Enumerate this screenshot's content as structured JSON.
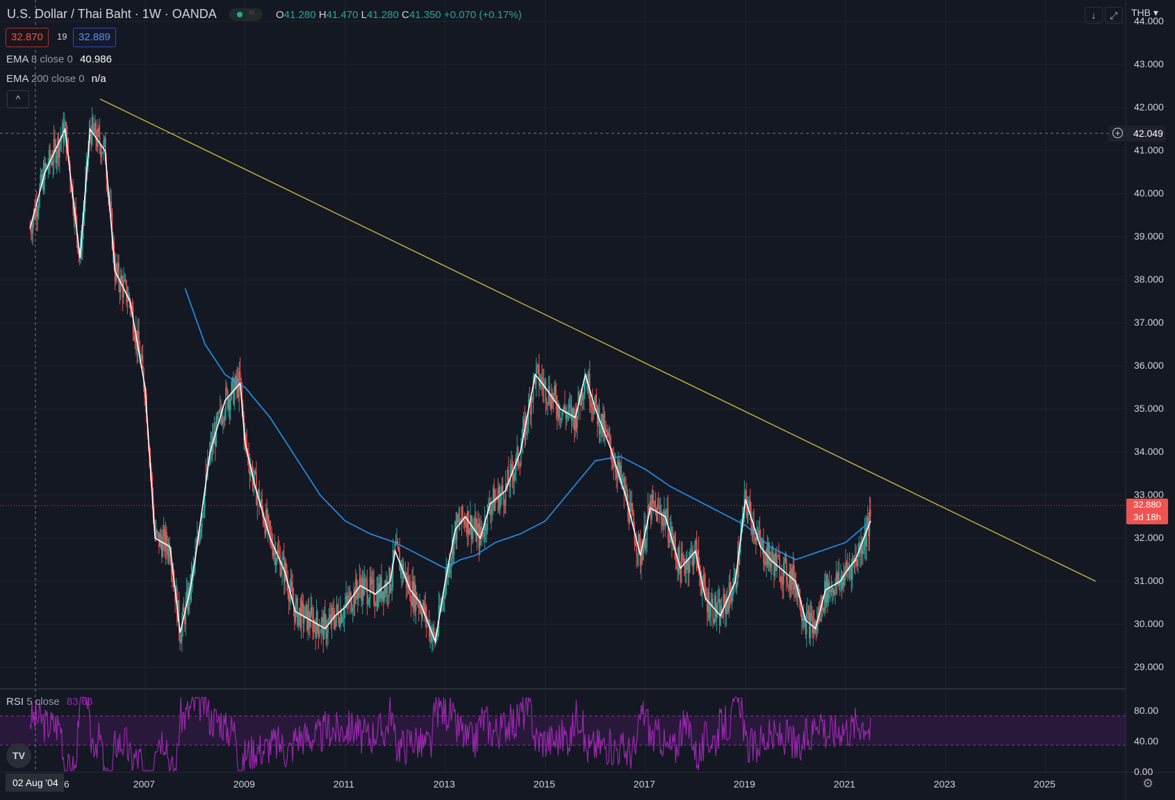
{
  "header": {
    "symbol": "U.S. Dollar / Thai Baht",
    "interval": "1W",
    "exchange": "OANDA",
    "ohlc": {
      "o_label": "O",
      "o": "41.280",
      "h_label": "H",
      "h": "41.470",
      "l_label": "L",
      "l": "41.280",
      "c_label": "C",
      "c": "41.350",
      "change": "+0.070 (+0.17%)"
    },
    "sell_price": "32.870",
    "spread": "19",
    "buy_price": "32.889"
  },
  "indicators": {
    "ema8": {
      "name": "EMA",
      "params": "8 close 0",
      "value": "40.986"
    },
    "ema200": {
      "name": "EMA",
      "params": "200 close 0",
      "value": "n/a"
    },
    "rsi": {
      "name": "RSI",
      "params": "5 close",
      "value": "83.66"
    }
  },
  "toolbar": {
    "collapse_icon": "^",
    "download_icon": "↓",
    "fullscreen_icon": "⤢",
    "currency": "THB ▾"
  },
  "price_axis": {
    "ticks": [
      "44.000",
      "43.000",
      "42.000",
      "41.000",
      "40.000",
      "39.000",
      "38.000",
      "37.000",
      "36.000",
      "35.000",
      "34.000",
      "33.000",
      "32.000",
      "31.000",
      "30.000",
      "29.000"
    ]
  },
  "rsi_axis": {
    "ticks": [
      "80.00",
      "40.00",
      "0.00"
    ]
  },
  "time_axis": {
    "ticks": [
      "2007",
      "2009",
      "2011",
      "2013",
      "2015",
      "2017",
      "2019",
      "2021",
      "2023",
      "2025"
    ],
    "first_partial": "6"
  },
  "crosshair": {
    "price": "42.049",
    "date": "02 Aug '04"
  },
  "last_price": {
    "value": "32.880",
    "countdown": "3d 18h"
  },
  "colors": {
    "background": "#141823",
    "up": "#26a69a",
    "down": "#ef5350",
    "ema8": "#ffffff",
    "ema200": "#2196f3",
    "trendline": "#c9b93c",
    "rsi": "#9c27b0"
  },
  "chart_data": {
    "type": "candlestick",
    "series": [
      {
        "name": "EMA 8 close 0",
        "x": [
          2004.7,
          2005.0,
          2005.4,
          2005.7,
          2005.9,
          2006.2,
          2006.4,
          2006.7,
          2007.0,
          2007.2,
          2007.5,
          2007.7,
          2007.9,
          2008.0,
          2008.3,
          2008.6,
          2008.9,
          2009.0,
          2009.2,
          2009.5,
          2009.8,
          2010.0,
          2010.3,
          2010.6,
          2010.8,
          2011.0,
          2011.3,
          2011.6,
          2011.9,
          2012.0,
          2012.3,
          2012.5,
          2012.8,
          2013.0,
          2013.2,
          2013.4,
          2013.7,
          2013.9,
          2014.2,
          2014.5,
          2014.8,
          2015.0,
          2015.3,
          2015.6,
          2015.8,
          2016.0,
          2016.3,
          2016.6,
          2016.9,
          2017.1,
          2017.4,
          2017.7,
          2018.0,
          2018.2,
          2018.5,
          2018.8,
          2019.0,
          2019.3,
          2019.5,
          2019.8,
          2020.0,
          2020.2,
          2020.4,
          2020.6,
          2020.9,
          2021.0,
          2021.2,
          2021.5
        ],
        "values": [
          39.2,
          40.5,
          41.5,
          38.5,
          41.5,
          41.0,
          38.2,
          37.5,
          35.5,
          32.0,
          31.8,
          29.8,
          30.8,
          31.5,
          34.0,
          35.2,
          35.6,
          34.2,
          33.2,
          32.0,
          31.2,
          30.3,
          30.1,
          29.9,
          30.2,
          30.4,
          30.9,
          30.7,
          31.0,
          31.7,
          30.8,
          30.5,
          29.6,
          31.0,
          32.2,
          32.5,
          32.0,
          32.8,
          33.1,
          34.0,
          35.8,
          35.5,
          35.0,
          34.8,
          35.8,
          35.0,
          34.1,
          33.0,
          31.6,
          32.7,
          32.5,
          31.3,
          31.7,
          30.6,
          30.2,
          31.0,
          32.9,
          31.8,
          31.5,
          31.2,
          31.0,
          30.1,
          29.9,
          30.8,
          31.0,
          31.2,
          31.5,
          32.4
        ]
      },
      {
        "name": "EMA 200 close 0",
        "x": [
          2007.8,
          2008.2,
          2008.6,
          2009.0,
          2009.5,
          2010.0,
          2010.5,
          2011.0,
          2011.5,
          2012.0,
          2012.5,
          2013.0,
          2013.3,
          2013.6,
          2014.0,
          2014.5,
          2015.0,
          2015.5,
          2016.0,
          2016.5,
          2017.0,
          2017.5,
          2018.0,
          2018.5,
          2019.0,
          2019.5,
          2020.0,
          2020.5,
          2021.0,
          2021.5
        ],
        "values": [
          37.8,
          36.5,
          35.8,
          35.5,
          34.8,
          33.9,
          33.0,
          32.4,
          32.1,
          31.9,
          31.6,
          31.3,
          31.5,
          31.6,
          31.9,
          32.1,
          32.4,
          33.1,
          33.8,
          33.9,
          33.6,
          33.2,
          32.9,
          32.6,
          32.3,
          31.8,
          31.5,
          31.7,
          31.9,
          32.4
        ]
      },
      {
        "name": "Trend line",
        "x": [
          2006.1,
          2026.0
        ],
        "values": [
          42.2,
          31.0
        ]
      }
    ],
    "ylim": [
      28.5,
      44.5
    ],
    "xlim": [
      2004.1,
      2026.6
    ],
    "rsi": {
      "ylim": [
        0,
        100
      ],
      "levels": [
        70,
        30
      ]
    }
  }
}
